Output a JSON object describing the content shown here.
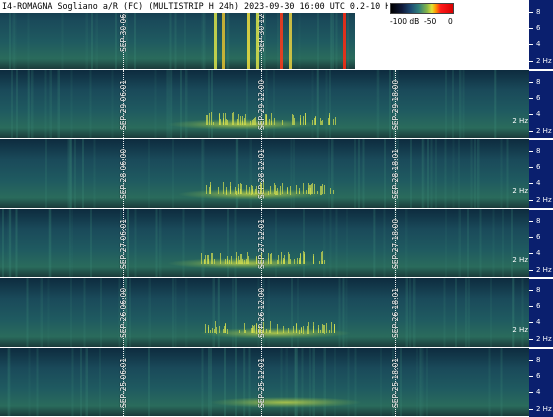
{
  "title": "I4-ROMAGNA Sogliano a/R (FC) (MULTISTRIP H 24h) 2023-09-30 16:00 UTC 0.2-10 Hz)",
  "colorscale": {
    "labels": [
      "-100 dB",
      "-50",
      "0"
    ]
  },
  "panels": [
    {
      "labels": [
        "SEP-30 06:01",
        "SEP-30 12:01"
      ],
      "hz_label": "2 Hz"
    },
    {
      "labels": [
        "SEP-29 06:01",
        "SEP-29 12:00",
        "SEP-29 18:00"
      ],
      "hz_label": "2 Hz"
    },
    {
      "labels": [
        "SEP-28 06:00",
        "SEP-28 12:01",
        "SEP-28 18:01"
      ],
      "hz_label": "2 Hz"
    },
    {
      "labels": [
        "SEP-27 06:01",
        "SEP-27 12:01",
        "SEP-27 18:00"
      ],
      "hz_label": "2 Hz"
    },
    {
      "labels": [
        "SEP-26 06:00",
        "SEP-26 12:00",
        "SEP-26 18:01"
      ],
      "hz_label": "2 Hz"
    },
    {
      "labels": [
        "SEP-25 06:01",
        "SEP-25 12:01",
        "SEP-25 18:01"
      ],
      "hz_label": ""
    }
  ],
  "freq_axis": {
    "labels": [
      "8",
      "6",
      "4",
      "2 Hz"
    ]
  },
  "colors": {
    "background": "#0b1a2e",
    "axis": "#0a1f6e",
    "signal": "#d9e34a",
    "spike": "#ff3a1a"
  }
}
